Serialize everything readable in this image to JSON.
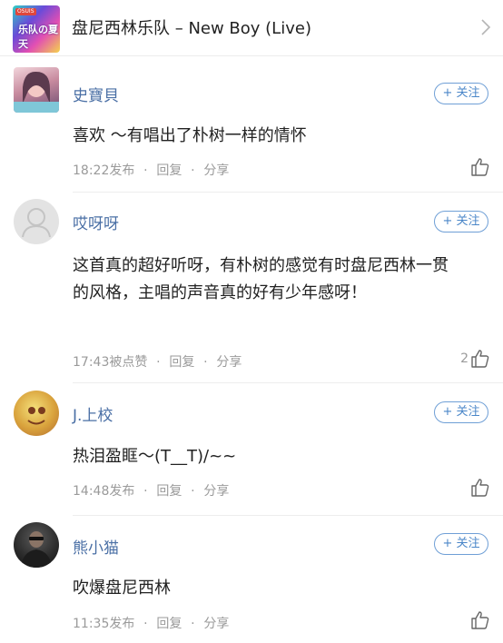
{
  "header": {
    "cover_badge": "OSUIS",
    "cover_text": "乐队の夏天",
    "song_title": "盘尼西林乐队 – New Boy (Live)",
    "chevron_icon": "chevron-right-icon"
  },
  "colors": {
    "username": "#4a6fa5",
    "follow_border": "#6f9fd6",
    "meta_text": "#9a9a9a"
  },
  "comments": [
    {
      "username": "史寶貝",
      "follow_label": "+ 关注",
      "text": "喜欢 ～有唱出了朴树一样的情怀",
      "time": "18:22发布",
      "reply_label": "回复",
      "share_label": "分享",
      "like_count": ""
    },
    {
      "username": "哎呀呀",
      "follow_label": "+ 关注",
      "text": "这首真的超好听呀，有朴树的感觉有时盘尼西林一贯的风格，主唱的声音真的好有少年感呀！",
      "time": "17:43被点赞",
      "reply_label": "回复",
      "share_label": "分享",
      "like_count": "2"
    },
    {
      "username": "J.上校",
      "follow_label": "+ 关注",
      "text": "热泪盈眶～(T__T)/~~",
      "time": "14:48发布",
      "reply_label": "回复",
      "share_label": "分享",
      "like_count": ""
    },
    {
      "username": "熊小猫",
      "follow_label": "+ 关注",
      "text": "吹爆盘尼西林",
      "time": "11:35发布",
      "reply_label": "回复",
      "share_label": "分享",
      "like_count": ""
    }
  ],
  "separator": "·"
}
